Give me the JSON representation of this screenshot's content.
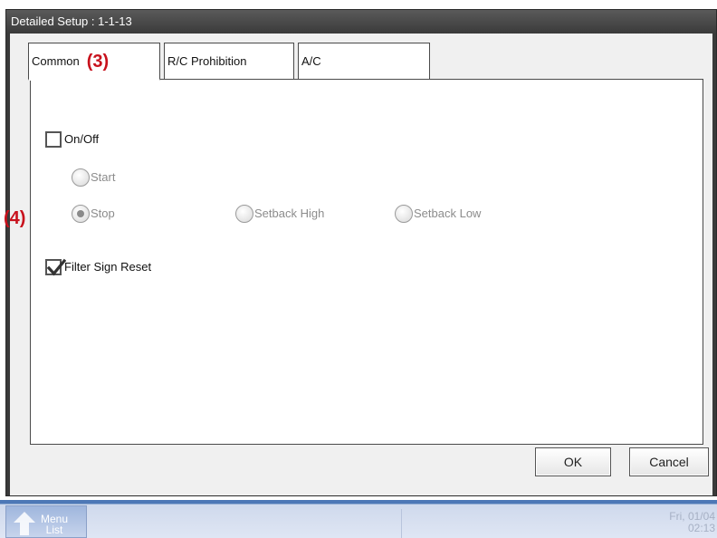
{
  "window": {
    "title": "Detailed Setup : 1-1-13"
  },
  "tabs": [
    {
      "label": "Common",
      "annotation": "(3)",
      "active": true
    },
    {
      "label": "R/C Prohibition",
      "active": false
    },
    {
      "label": "A/C",
      "active": false
    }
  ],
  "common": {
    "on_off": {
      "label": "On/Off",
      "checked": false
    },
    "radios": {
      "start": {
        "label": "Start",
        "selected": false
      },
      "stop": {
        "label": "Stop",
        "selected": true
      },
      "setback_high": {
        "label": "Setback High",
        "selected": false
      },
      "setback_low": {
        "label": "Setback Low",
        "selected": false
      }
    },
    "filter_sign_reset": {
      "label": "Filter Sign Reset",
      "checked": true,
      "annotation": "(4)"
    }
  },
  "buttons": {
    "ok": "OK",
    "cancel": "Cancel"
  },
  "taskbar": {
    "menu_line1": "Menu",
    "menu_line2": "List",
    "date": "Fri, 01/04",
    "time": "02:13"
  },
  "colors": {
    "annotation": "#c8121d",
    "taskbar_accent": "#4d78b6"
  },
  "icons": {
    "checkmark": "check-icon",
    "menu_arrow": "arrow-up-icon"
  }
}
